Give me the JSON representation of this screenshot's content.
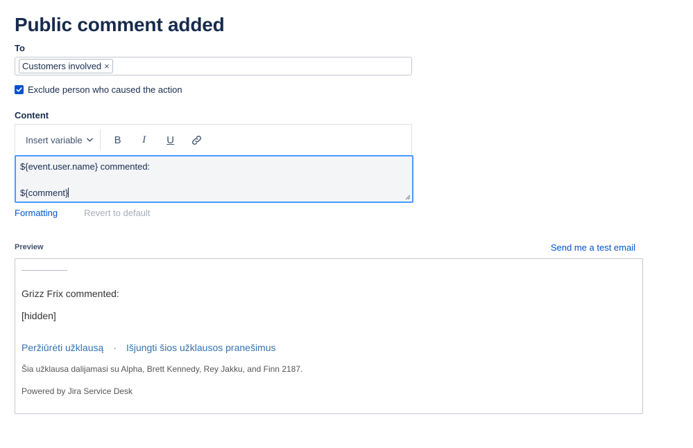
{
  "page": {
    "title": "Public comment added"
  },
  "to": {
    "label": "To",
    "tags": [
      {
        "label": "Customers involved",
        "remove": "×"
      }
    ]
  },
  "exclude": {
    "label": "Exclude person who caused the action",
    "checked": true
  },
  "content": {
    "label": "Content",
    "toolbar": {
      "insert_variable": "Insert variable",
      "bold": "B",
      "italic": "I",
      "underline": "U"
    },
    "lines": [
      "${event.user.name} commented:",
      "",
      "${comment}"
    ]
  },
  "links": {
    "formatting": "Formatting",
    "revert": "Revert to default"
  },
  "preview": {
    "label": "Preview",
    "test_email": "Send me a test email",
    "commented": "Grizz Frix commented:",
    "hidden": "[hidden]",
    "view_link": "Peržiūrėti užklausą",
    "separator": "·",
    "unsubscribe_link": "Išjungti šios užklausos pranešimus",
    "shared": "Šia užklausa dalijamasi su Alpha, Brett Kennedy, Rey Jakku, and Finn 2187.",
    "powered": "Powered by Jira Service Desk"
  },
  "colors": {
    "accent": "#0052cc",
    "focus": "#4c9aff",
    "text": "#172b4d"
  }
}
